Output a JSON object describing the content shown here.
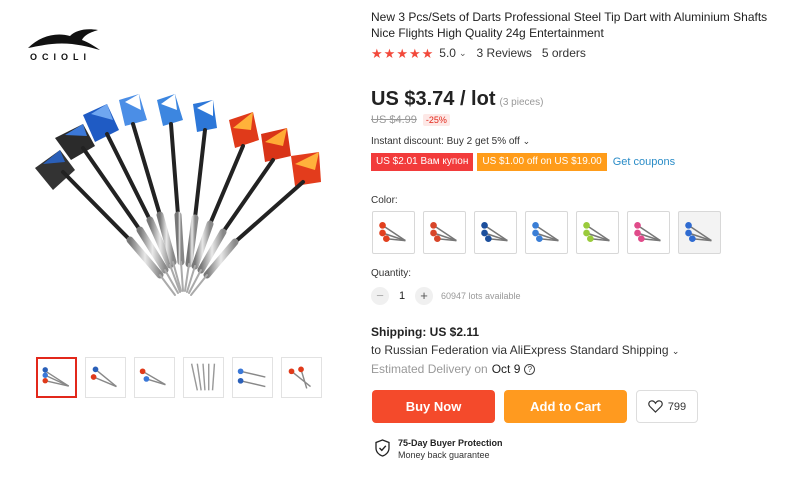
{
  "brand": {
    "logo_text": "OCIOLI"
  },
  "product": {
    "title": "New 3 Pcs/Sets of Darts Professional Steel Tip Dart with Aluminium Shafts Nice Flights High Quality 24g Entertainment",
    "rating": {
      "stars": 5,
      "value": "5.0",
      "reviews": "3 Reviews",
      "orders": "5 orders"
    },
    "price": "US $3.74 / lot",
    "price_unit": "(3 pieces)",
    "old_price": "US $4.99",
    "discount": "-25%",
    "instant_discount": "Instant discount: Buy 2 get 5% off",
    "coupons": [
      "US $2.01 Вам купон",
      "US $1.00 off on US $19.00"
    ],
    "get_coupons": "Get coupons",
    "color_label": "Color:",
    "colors": [
      {
        "name": "red-flame-1",
        "flight": "#e2401f"
      },
      {
        "name": "red-flame-2",
        "flight": "#d8462a"
      },
      {
        "name": "blue-1",
        "flight": "#1c4f9c"
      },
      {
        "name": "blue-2",
        "flight": "#3a7ed6"
      },
      {
        "name": "green",
        "flight": "#9acb3c"
      },
      {
        "name": "pink",
        "flight": "#e04b8a"
      },
      {
        "name": "blue-3",
        "flight": "#2f6bd1"
      }
    ],
    "selected_color_index": 6,
    "quantity_label": "Quantity:",
    "quantity": "1",
    "lots_available": "60947 lots available",
    "shipping": "Shipping: US $2.11",
    "ship_to": "to Russian Federation via AliExpress Standard Shipping",
    "delivery_prefix": "Estimated Delivery on",
    "delivery_date": "Oct 9",
    "buy_now": "Buy Now",
    "add_to_cart": "Add to Cart",
    "wishlist_count": "799",
    "protection_title": "75-Day Buyer Protection",
    "protection_sub": "Money back guarantee"
  },
  "gallery": {
    "thumbnail_count": 6,
    "active_index": 0
  },
  "colors_theme": {
    "accent_red": "#f44a2b",
    "accent_orange": "#ff9a1f",
    "star": "#f2493b",
    "link": "#2a8cc7"
  }
}
